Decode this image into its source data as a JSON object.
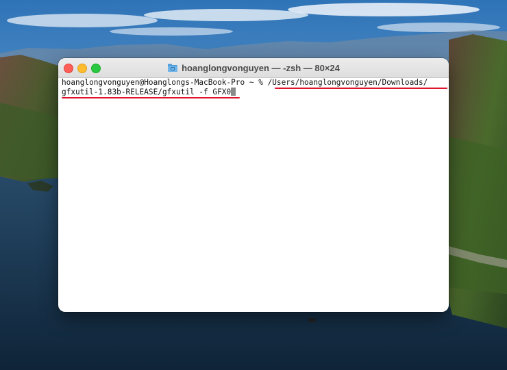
{
  "window": {
    "title": "hoanglongvonguyen — -zsh — 80×24"
  },
  "terminal": {
    "prompt": "hoanglongvonguyen@Hoanglongs-MacBook-Pro ~ % ",
    "command_line1": "/Users/hoanglongvonguyen/Downloads/",
    "command_line2": "gfxutil-1.83b-RELEASE/gfxutil -f GFX0"
  },
  "colors": {
    "annotation_underline": "#e0142c",
    "close": "#ff5f57",
    "minimize": "#febc2e",
    "zoom": "#28c840"
  },
  "icons": {
    "title": "folder-icon"
  }
}
